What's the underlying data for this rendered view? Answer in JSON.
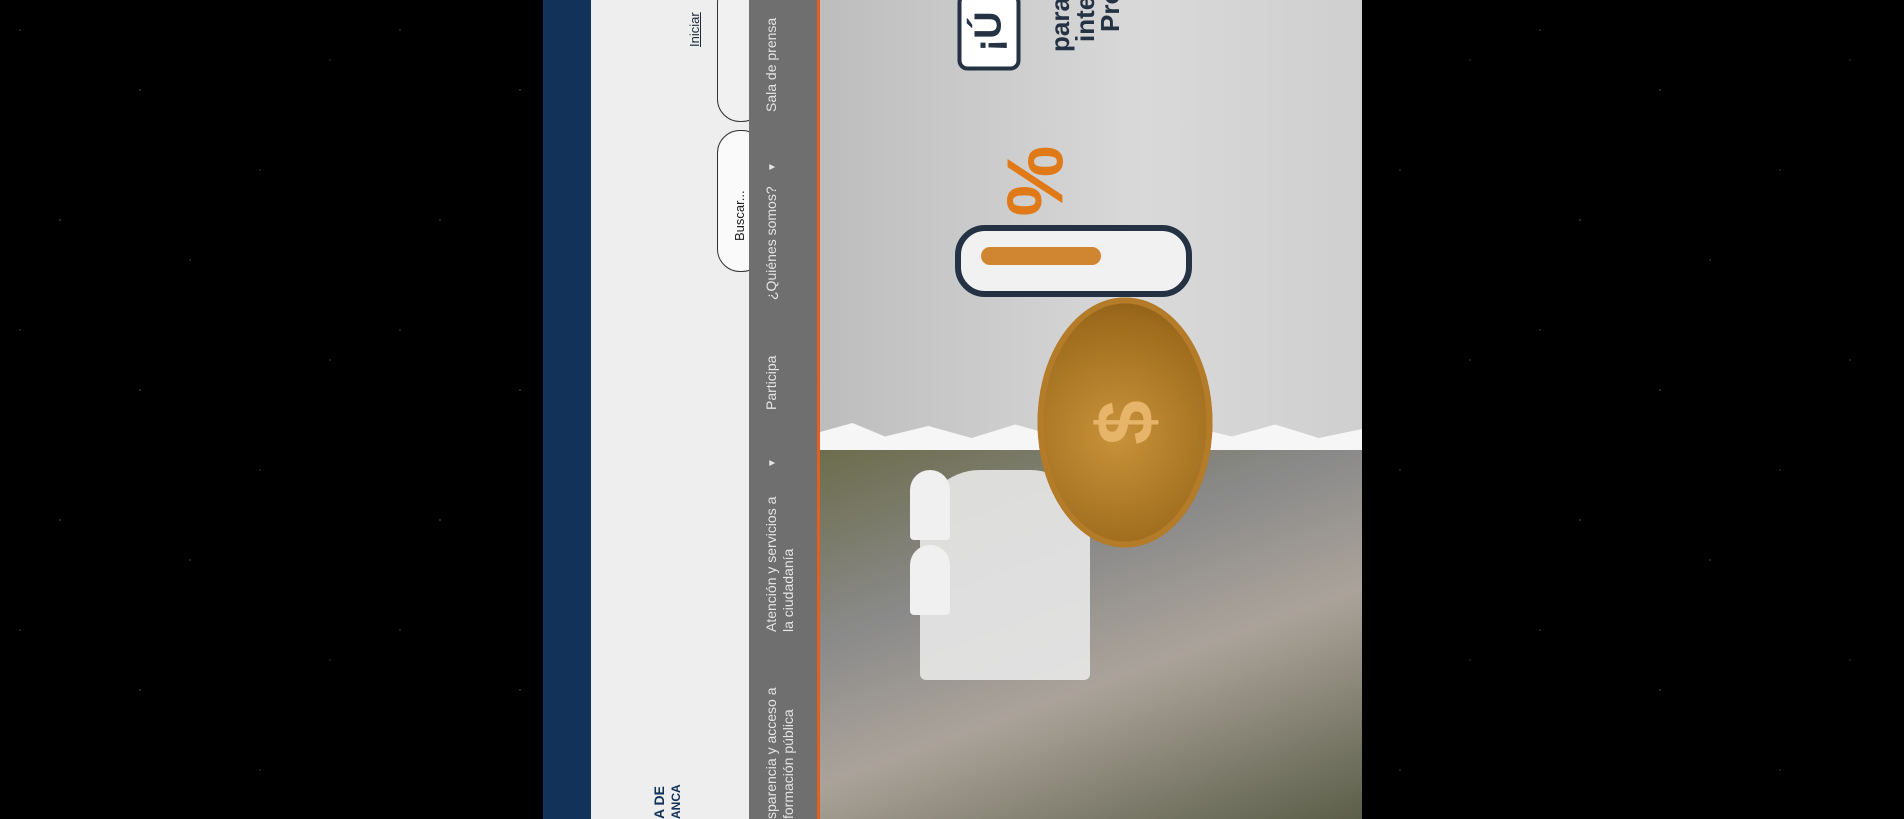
{
  "header": {
    "login_link": "Iniciar",
    "logo_text_1": "A DE",
    "logo_text_2": "ANCA",
    "search_placeholder": "Buscar..."
  },
  "nav": {
    "items": [
      {
        "label": "Sala de prensa"
      },
      {
        "label": "¿Quiénes somos?"
      },
      {
        "label": "Participa"
      },
      {
        "label": "Atención y servicios a la ciudadanía"
      },
      {
        "label": "sparencia y acceso a formación pública"
      }
    ]
  },
  "hero": {
    "badge_text": "¡Ú",
    "headline_lines": [
      "para",
      "inte",
      "Pro"
    ],
    "coin_symbol": "$",
    "percent_symbol": "%"
  },
  "colors": {
    "brand_blue": "#13325a",
    "accent_orange": "#e06020",
    "nav_gray": "#6f6f6f"
  }
}
